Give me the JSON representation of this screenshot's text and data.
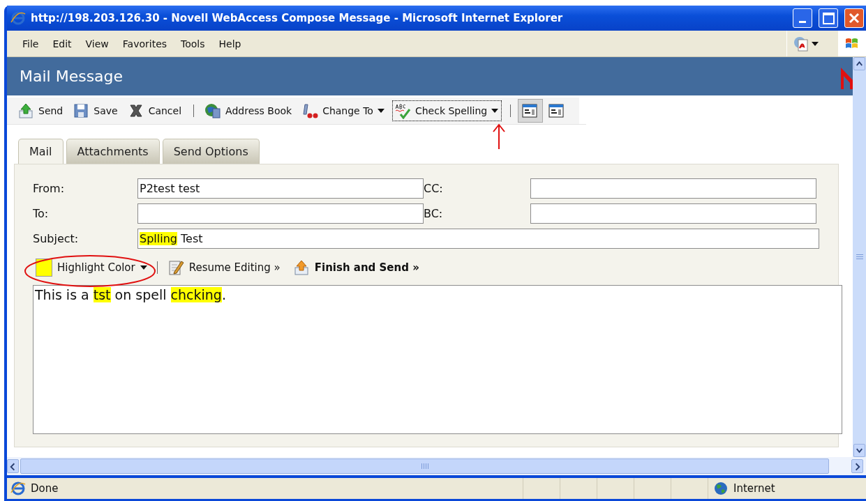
{
  "window": {
    "title": "http://198.203.126.30 - Novell WebAccess Compose Message - Microsoft Internet Explorer"
  },
  "menu": [
    "File",
    "Edit",
    "View",
    "Favorites",
    "Tools",
    "Help"
  ],
  "page": {
    "heading": "Mail Message"
  },
  "toolbar": [
    {
      "kind": "button",
      "label": "Send"
    },
    {
      "kind": "button",
      "label": "Save"
    },
    {
      "kind": "button",
      "label": "Cancel"
    },
    {
      "kind": "separator"
    },
    {
      "kind": "button",
      "label": "Address Book"
    },
    {
      "kind": "dropdown",
      "label": "Change To",
      "focused": false
    },
    {
      "kind": "dropdown",
      "label": "Check Spelling",
      "focused": true
    },
    {
      "kind": "separator"
    },
    {
      "kind": "toggle",
      "selected": true
    },
    {
      "kind": "toggle",
      "selected": false
    }
  ],
  "tabs": [
    {
      "label": "Mail",
      "selected": true
    },
    {
      "label": "Attachments",
      "selected": false
    },
    {
      "label": "Send Options",
      "selected": false
    }
  ],
  "fields": [
    {
      "label": "From:",
      "value": "P2test test"
    },
    {
      "label": "CC:"
    },
    {
      "label": "To:"
    },
    {
      "label": "BC:"
    }
  ],
  "subject": {
    "label": "Subject:",
    "segments": [
      {
        "text": "Splling",
        "highlighted": true
      },
      {
        "text": " Test",
        "highlighted": false
      }
    ]
  },
  "editor_toolbar": [
    {
      "kind": "color",
      "label": "Highlight Color",
      "color": "#ffff00"
    },
    {
      "kind": "resume",
      "label": "Resume Editing »"
    },
    {
      "kind": "finish",
      "label": "Finish and Send »"
    }
  ],
  "body": {
    "segments": [
      {
        "text": "This is a ",
        "highlighted": false
      },
      {
        "text": "tst",
        "highlighted": true
      },
      {
        "text": " on spell ",
        "highlighted": false
      },
      {
        "text": "chcking",
        "highlighted": true
      },
      {
        "text": ".",
        "highlighted": false
      }
    ]
  },
  "status_bar": {
    "text": "Done",
    "zone": "Internet"
  }
}
